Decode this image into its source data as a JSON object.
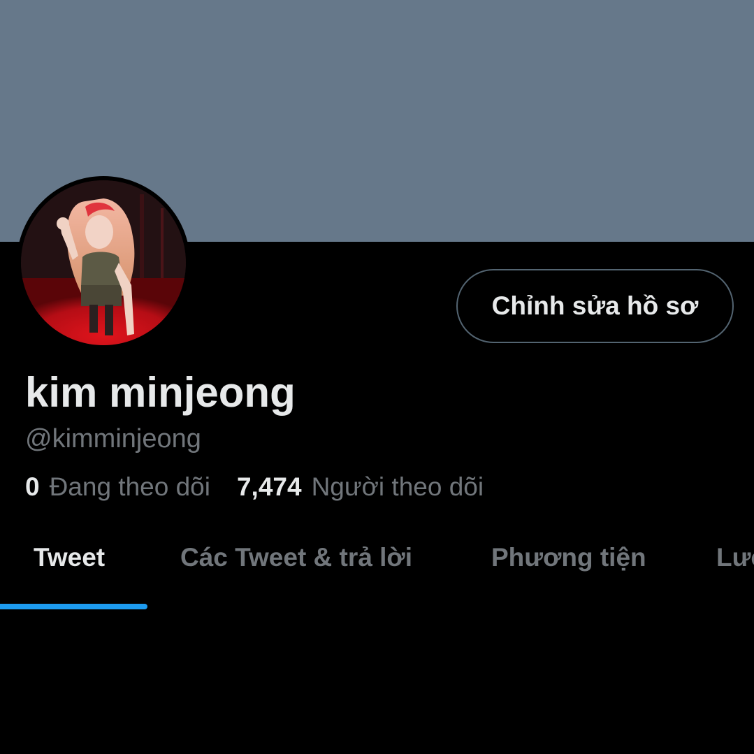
{
  "colors": {
    "banner": "#66788a",
    "background": "#000000",
    "primary_text": "#e7e9ea",
    "secondary_text": "#71767b",
    "accent": "#1d9bf0",
    "button_border": "#536471"
  },
  "profile": {
    "display_name": "kim minjeong",
    "handle": "@kimminjeong",
    "edit_button_label": "Chỉnh sửa hồ sơ",
    "avatar_icon": "profile-photo"
  },
  "stats": {
    "following_count": "0",
    "following_label": "Đang theo dõi",
    "followers_count": "7,474",
    "followers_label": "Người theo dõi"
  },
  "tabs": [
    {
      "label": "Tweet",
      "active": true
    },
    {
      "label": "Các Tweet & trả lời",
      "active": false
    },
    {
      "label": "Phương tiện",
      "active": false
    },
    {
      "label": "Lượt thích",
      "active": false
    }
  ]
}
